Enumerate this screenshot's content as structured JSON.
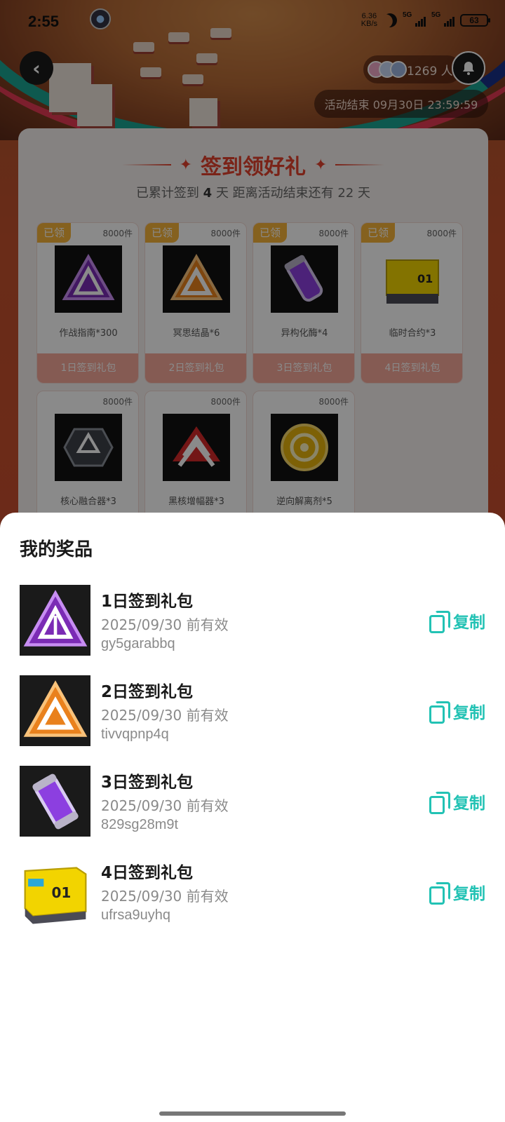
{
  "status_bar": {
    "time": "2:55",
    "net_speed_top": "6.36",
    "net_speed_bottom": "KB/s",
    "signal1_label": "5G",
    "signal2_label": "5G",
    "battery": "63"
  },
  "header": {
    "participants_count": "1269 人",
    "activity_end": "活动结束 09月30日 23:59:59"
  },
  "sign_in": {
    "title": "签到领好礼",
    "subtitle_prefix": "已累计签到",
    "days_signed": "4",
    "subtitle_mid": "天  距离活动结束还有",
    "days_left": "22",
    "subtitle_suffix": "天",
    "cards": [
      {
        "tag": "已领",
        "stock": "8000件",
        "name": "作战指南*300",
        "pack": "1日签到礼包",
        "icon": "purple-triangle-emblem-icon"
      },
      {
        "tag": "已领",
        "stock": "8000件",
        "name": "冥思结晶*6",
        "pack": "2日签到礼包",
        "icon": "orange-triangle-emblem-icon"
      },
      {
        "tag": "已领",
        "stock": "8000件",
        "name": "异构化酶*4",
        "pack": "3日签到礼包",
        "icon": "purple-vial-icon"
      },
      {
        "tag": "已领",
        "stock": "8000件",
        "name": "临时合约*3",
        "pack": "4日签到礼包",
        "icon": "yellow-crate-icon"
      },
      {
        "stock": "8000件",
        "name": "核心融合器*3",
        "icon": "core-fusion-icon"
      },
      {
        "stock": "8000件",
        "name": "黑核增幅器*3",
        "icon": "red-chevron-icon"
      },
      {
        "stock": "8000件",
        "name": "逆向解离剂*5",
        "icon": "yellow-ring-icon"
      }
    ]
  },
  "sheet": {
    "title": "我的奖品",
    "copy_label": "复制",
    "prizes": [
      {
        "name": "1日签到礼包",
        "valid": "2025/09/30 前有效",
        "code": "gy5garabbq",
        "icon": "purple-triangle-emblem-icon"
      },
      {
        "name": "2日签到礼包",
        "valid": "2025/09/30 前有效",
        "code": "tivvqpnp4q",
        "icon": "orange-triangle-emblem-icon"
      },
      {
        "name": "3日签到礼包",
        "valid": "2025/09/30 前有效",
        "code": "829sg28m9t",
        "icon": "purple-vial-icon"
      },
      {
        "name": "4日签到礼包",
        "valid": "2025/09/30 前有效",
        "code": "ufrsa9uyhq",
        "icon": "yellow-crate-icon"
      }
    ]
  },
  "colors": {
    "accent_copy": "#22c2b4",
    "sign_title": "#e2412d",
    "claimed_tag": "#f6b33a",
    "pack_button": "#f6a89a"
  }
}
